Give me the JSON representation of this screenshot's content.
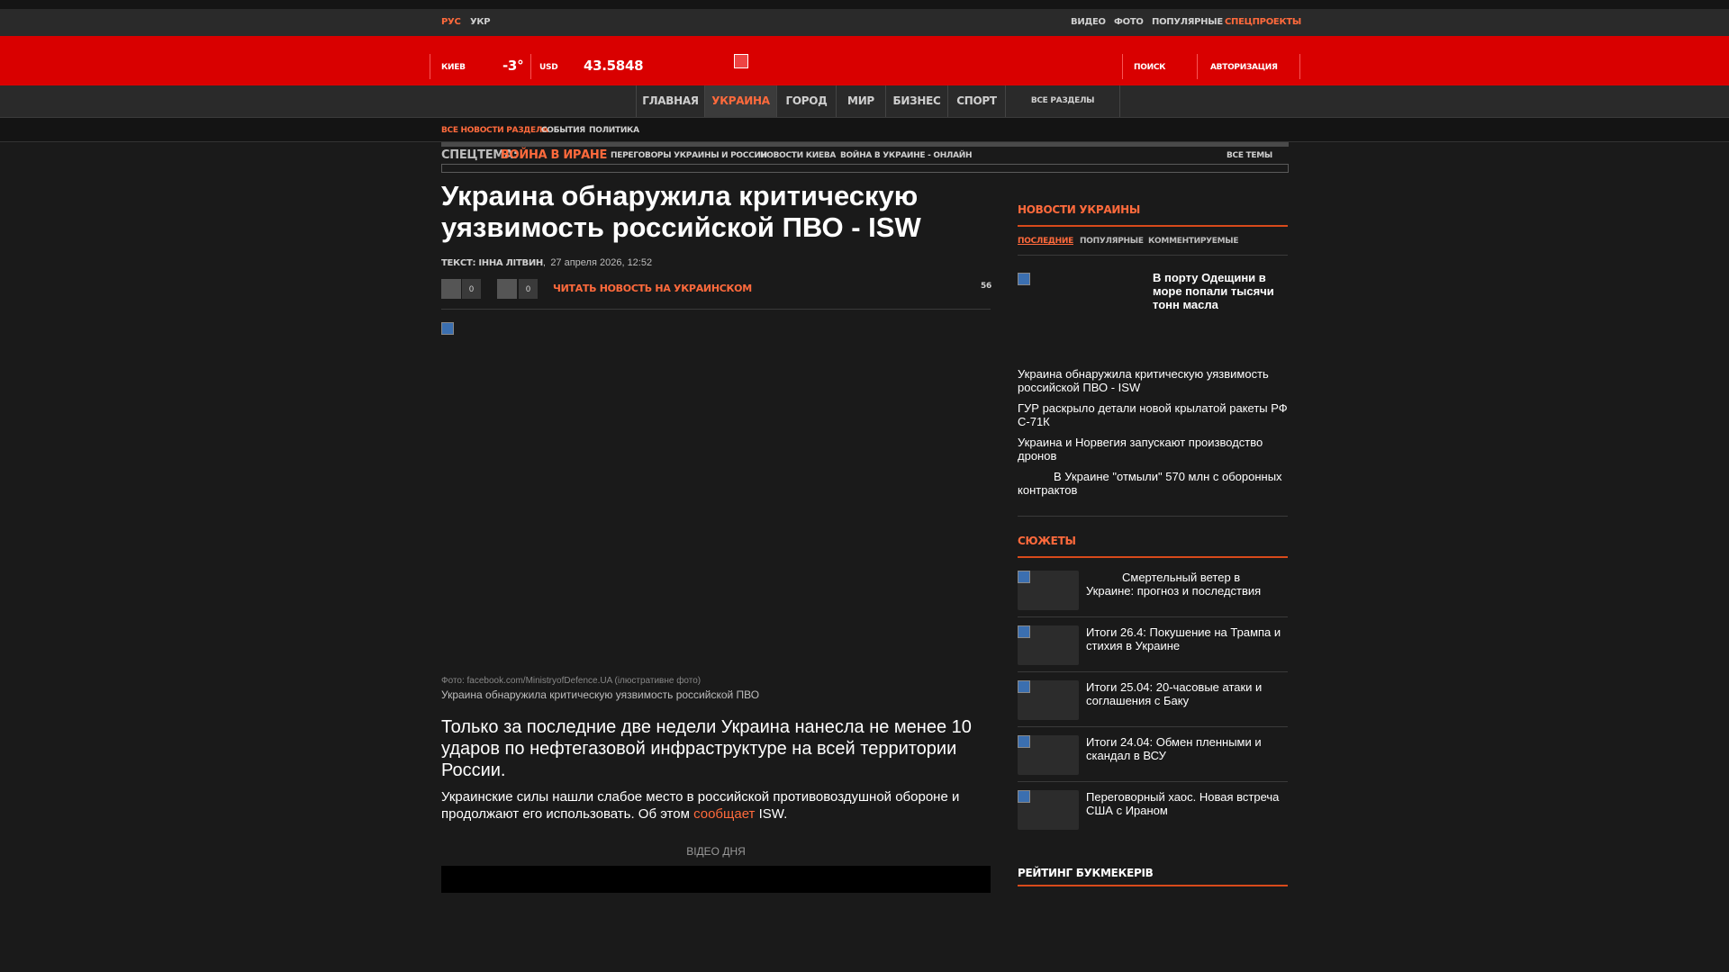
{
  "topbar": {
    "lang_ru": "РУС",
    "lang_ua": "УКР",
    "nav": [
      "ВИДЕО",
      "ФОТО",
      "ПОПУЛЯРНЫЕ",
      "СПЕЦПРОЕКТЫ"
    ]
  },
  "header": {
    "city": "КИЕВ",
    "temperature": "-3°",
    "currency": "USD",
    "rate": "43.5848",
    "search": "ПОИСК",
    "auth": "АВТОРИЗАЦИЯ"
  },
  "main_nav": {
    "items": [
      "ГЛАВНАЯ",
      "УКРАИНА",
      "ГОРОД",
      "МИР",
      "БИЗНЕС",
      "СПОРТ"
    ],
    "active_index": 1,
    "all_sections": "ВСЕ РАЗДЕЛЫ"
  },
  "sub_nav": {
    "items": [
      "ВСЕ НОВОСТИ РАЗДЕЛА",
      "СОБЫТИЯ",
      "ПОЛИТИКА"
    ]
  },
  "special_topic": {
    "label": "СПЕЦТЕМА:",
    "title": "ВОЙНА В ИРАНЕ",
    "links": [
      "ПЕРЕГОВОРЫ УКРАИНЫ И РОССИИ",
      "НОВОСТИ КИЕВА",
      "ВОЙНА В УКРАИНЕ - ОНЛАЙН"
    ],
    "all_topics": "ВСЕ ТЕМЫ"
  },
  "article": {
    "title": "Украина обнаружила критическую уязвимость российской ПВО - ISW",
    "author_label": "ТЕКСТ: ІННА ЛІТВИН",
    "date": "27 апреля 2026, 12:52",
    "like_count": "0",
    "dislike_count": "0",
    "read_ukrainian": "ЧИТАТЬ НОВОСТЬ НА УКРАИНСКОМ",
    "views": "56",
    "photo_credit": "Фото: facebook.com/MinistryofDefence.UA (ілюстративне фото)",
    "photo_caption": "Украина обнаружила критическую уязвимость российской ПВО",
    "lead": "Только за последние две недели Украина нанесла не менее 10 ударов по нефтегазовой инфраструктуре на всей территории России.",
    "body_before_link": "Украинские силы нашли слабое место в российской противовоздушной обороне и продолжают его использовать. Об этом ",
    "body_link": "сообщает",
    "body_after_link": " ISW.",
    "video_label": "ВІДЕО ДНЯ"
  },
  "sidebar": {
    "news_title": "НОВОСТИ УКРАИНЫ",
    "tabs": [
      "ПОСЛЕДНИЕ",
      "ПОПУЛЯРНЫЕ",
      "КОММЕНТИРУЕМЫЕ"
    ],
    "featured": "В порту Одещини в море попали тысячи тонн масла",
    "news": [
      "Украина обнаружила критическую уязвимость российской ПВО - ISW",
      "ГУР раскрыло детали новой крылатой ракеты РФ С-71К",
      "Украина и Норвегия запускают производство дронов",
      "В Украине \"отмыли\" 570 млн с оборонных контрактов"
    ],
    "stories_title": "СЮЖЕТЫ",
    "stories": [
      "Смертельный ветер в Украине: прогноз и последствия",
      "Итоги 26.4: Покушение на Трампа и стихия в Украине",
      "Итоги 25.04: 20-часовые атаки и соглашения с Баку",
      "Итоги 24.04: Обмен пленными и скандал в ВСУ",
      "Переговорный хаос. Новая встреча США с Ираном"
    ],
    "ratings_title": "РЕЙТИНГ БУКМЕКЕРІВ"
  },
  "colors": {
    "accent": "#ff6a3c",
    "header_red": "#d90000",
    "background": "#1a1a1a"
  }
}
